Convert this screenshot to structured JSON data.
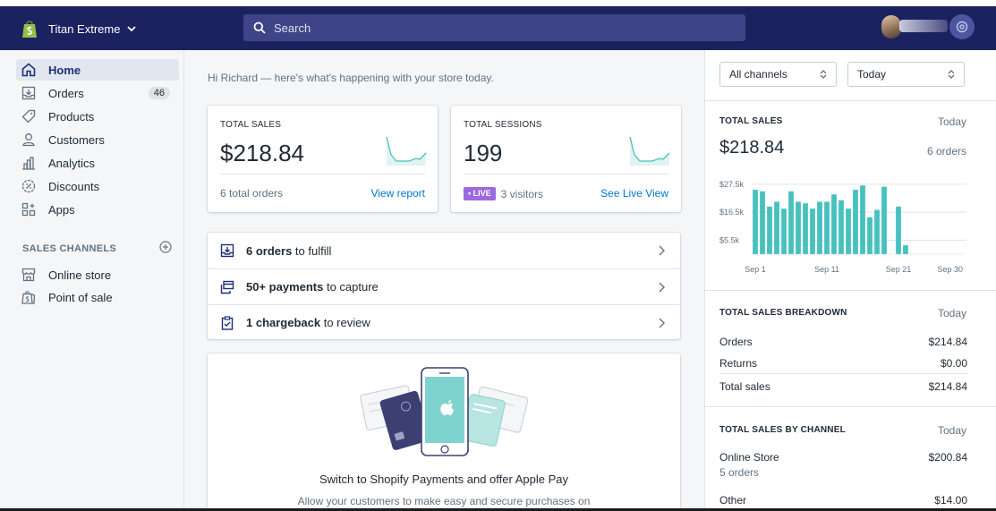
{
  "topbar": {
    "store_name": "Titan Extreme",
    "search_placeholder": "Search"
  },
  "sidebar": {
    "items": [
      {
        "label": "Home",
        "icon": "home-icon",
        "active": true
      },
      {
        "label": "Orders",
        "icon": "orders-icon",
        "badge": "46"
      },
      {
        "label": "Products",
        "icon": "tag-icon"
      },
      {
        "label": "Customers",
        "icon": "person-icon"
      },
      {
        "label": "Analytics",
        "icon": "bar-chart-icon"
      },
      {
        "label": "Discounts",
        "icon": "discount-icon"
      },
      {
        "label": "Apps",
        "icon": "apps-icon"
      }
    ],
    "sales_channels_heading": "SALES CHANNELS",
    "channels": [
      {
        "label": "Online store",
        "icon": "storefront-icon"
      },
      {
        "label": "Point of sale",
        "icon": "pos-bag-icon"
      }
    ]
  },
  "main": {
    "greeting": "Hi Richard — here's what's happening with your store today.",
    "total_sales": {
      "label": "TOTAL SALES",
      "value": "$218.84",
      "footer": "6 total orders",
      "link": "View report"
    },
    "total_sessions": {
      "label": "TOTAL SESSIONS",
      "value": "199",
      "live_badge": "• LIVE",
      "footer": "3 visitors",
      "link": "See Live View"
    },
    "tasks": [
      {
        "bold": "6 orders",
        "rest": " to fulfill",
        "icon": "fulfill-icon"
      },
      {
        "bold": "50+ payments",
        "rest": " to capture",
        "icon": "payment-icon"
      },
      {
        "bold": "1 chargeback",
        "rest": " to review",
        "icon": "clipboard-icon"
      }
    ],
    "promo": {
      "title": "Switch to Shopify Payments and offer Apple Pay",
      "description": "Allow your customers to make easy and secure purchases on"
    }
  },
  "right_panel": {
    "channel_select": "All channels",
    "date_select": "Today",
    "total_sales": {
      "heading": "TOTAL SALES",
      "period": "Today",
      "value": "$218.84",
      "orders": "6 orders"
    },
    "breakdown": {
      "heading": "TOTAL SALES BREAKDOWN",
      "period": "Today",
      "rows": [
        {
          "label": "Orders",
          "value": "$214.84"
        },
        {
          "label": "Returns",
          "value": "$0.00"
        },
        {
          "label": "Total sales",
          "value": "$214.84"
        }
      ]
    },
    "by_channel": {
      "heading": "TOTAL SALES BY CHANNEL",
      "period": "Today",
      "rows": [
        {
          "label": "Online Store",
          "sub": "5 orders",
          "value": "$200.84"
        },
        {
          "label": "Other",
          "value": "$14.00"
        }
      ]
    }
  },
  "colors": {
    "topbar": "#1c2260",
    "accent_link": "#007ace",
    "bar": "#47c1bf",
    "live": "#9c6ade"
  },
  "chart_data": {
    "type": "bar",
    "y_ticks": [
      "$27.5k",
      "$16.5k",
      "$5.5k"
    ],
    "y_tick_values": [
      27500,
      16500,
      5500
    ],
    "ylim": [
      0,
      30250
    ],
    "x_ticks": [
      "Sep 1",
      "Sep 11",
      "Sep 21",
      "Sep 30"
    ],
    "categories": [
      "Sep 1",
      "Sep 2",
      "Sep 3",
      "Sep 4",
      "Sep 5",
      "Sep 6",
      "Sep 7",
      "Sep 8",
      "Sep 9",
      "Sep 10",
      "Sep 11",
      "Sep 12",
      "Sep 13",
      "Sep 14",
      "Sep 15",
      "Sep 16",
      "Sep 17",
      "Sep 18",
      "Sep 19",
      "Sep 20",
      "Sep 21",
      "Sep 22",
      "Sep 23",
      "Sep 24",
      "Sep 25",
      "Sep 26",
      "Sep 27",
      "Sep 28",
      "Sep 29",
      "Sep 30"
    ],
    "values": [
      25300,
      24700,
      18700,
      20600,
      17900,
      24700,
      20600,
      20000,
      17900,
      20600,
      20600,
      23500,
      21200,
      17900,
      25300,
      27000,
      14500,
      17400,
      26500,
      0,
      18700,
      3500,
      0,
      0,
      0,
      0,
      0,
      0,
      0,
      0
    ]
  }
}
